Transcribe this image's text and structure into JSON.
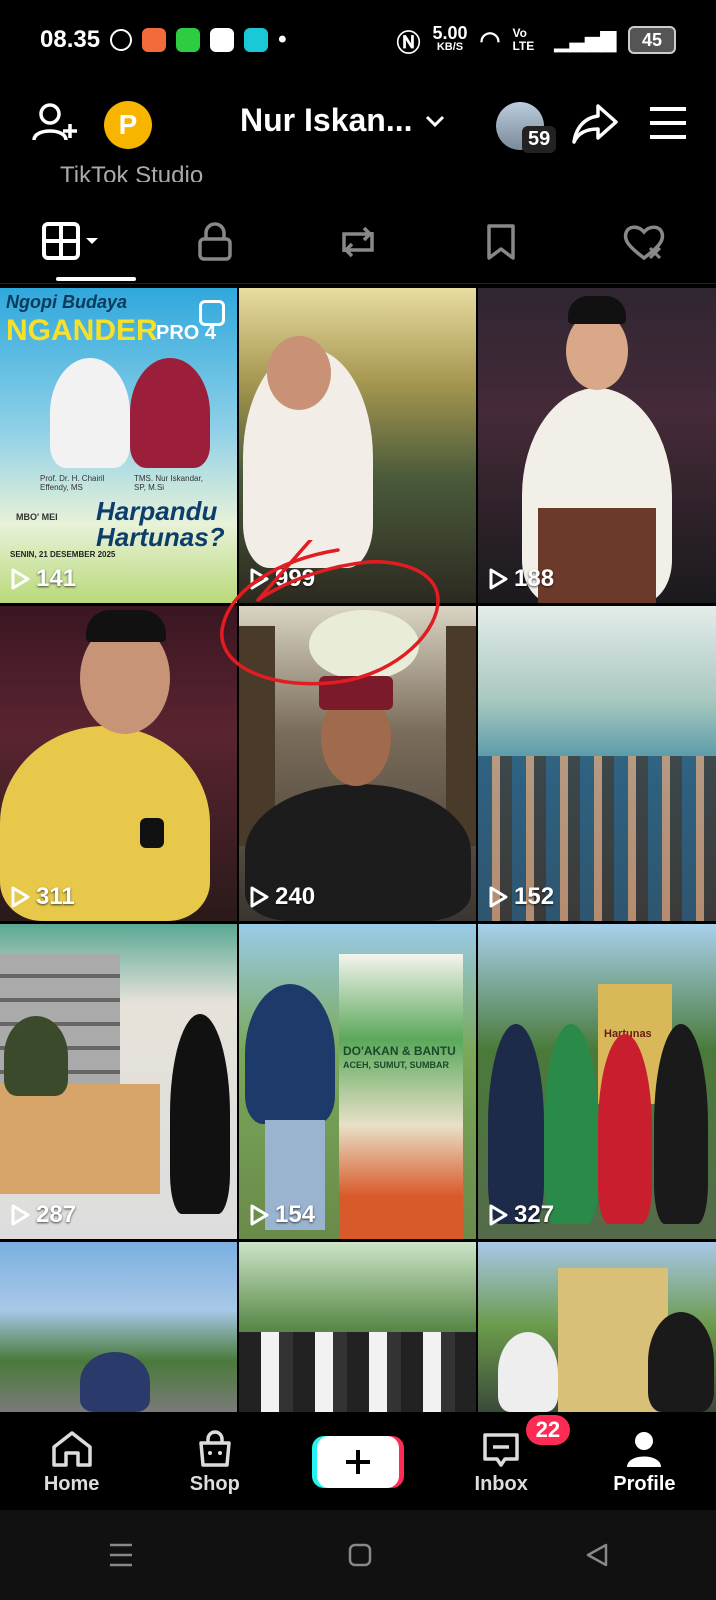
{
  "status_bar": {
    "time": "08.35",
    "speed_value": "5.00",
    "speed_unit": "KB/S",
    "network": "Vo LTE",
    "battery": "45"
  },
  "header": {
    "profile_name": "Nur Iskan...",
    "avatar_count": "59",
    "coin_letter": "P"
  },
  "studio_label": "TikTok Studio",
  "tabs": [
    {
      "name": "videos",
      "icon": "grid-icon",
      "active": true
    },
    {
      "name": "private",
      "icon": "lock-icon"
    },
    {
      "name": "reposts",
      "icon": "repost-icon"
    },
    {
      "name": "favorites",
      "icon": "bookmark-icon"
    },
    {
      "name": "liked",
      "icon": "heart-icon"
    }
  ],
  "videos": [
    {
      "views": "141",
      "bg": "#2c9fd6"
    },
    {
      "views": "999",
      "bg": "#7d7a52"
    },
    {
      "views": "188",
      "bg": "#2a2630"
    },
    {
      "views": "311",
      "bg": "#3a1a24"
    },
    {
      "views": "240",
      "bg": "#6b6a5e"
    },
    {
      "views": "152",
      "bg": "#6d9a8e"
    },
    {
      "views": "287",
      "bg": "#e8e3dc"
    },
    {
      "views": "154",
      "bg": "#6b8c5a"
    },
    {
      "views": "327",
      "bg": "#5f8a4a"
    },
    {
      "views": "",
      "bg": "#7aa8d8"
    },
    {
      "views": "",
      "bg": "#6d8a5a"
    },
    {
      "views": "",
      "bg": "#8aa66a"
    }
  ],
  "poster": {
    "top_title": "Ngopi Budaya",
    "headline": "NGANDER",
    "pro_label": "PRO 4",
    "bottom_title": "Harpandu Hartunas?",
    "person_left": "Prof. Dr. H. Chairil Effendy, MS",
    "person_right": "TMS. Nur Iskandar, SP, M.Si",
    "host": "MBO' MEI",
    "date": "SENIN, 21 DESEMBER 2025"
  },
  "banner_text": {
    "banner_1": "DO'AKAN & BANTU",
    "banner_1_sub": "ACEH, SUMUT, SUMBAR",
    "banner_2": "Hartunas"
  },
  "nav": {
    "home": "Home",
    "shop": "Shop",
    "inbox": "Inbox",
    "inbox_badge": "22",
    "profile": "Profile"
  }
}
